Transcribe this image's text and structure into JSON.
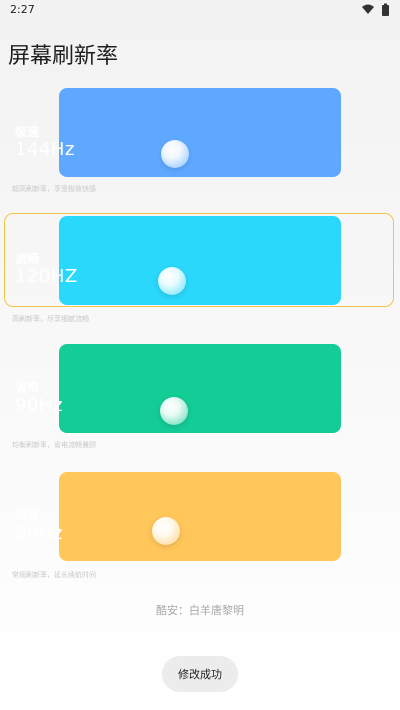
{
  "status_bar": {
    "time": "2:27",
    "icons": [
      "wifi-icon",
      "battery-icon"
    ]
  },
  "header": {
    "title": "屏幕刷新率"
  },
  "modes": [
    {
      "name": "极速",
      "rate": "144Hz",
      "description": "超高刷新率，享受极致快感",
      "color": "#5ea9ff",
      "selected": false
    },
    {
      "name": "流畅",
      "rate": "120HZ",
      "description": "高刷新率，尽享细腻流畅",
      "color": "#2ad8fb",
      "selected": true
    },
    {
      "name": "省电",
      "rate": "90Hz",
      "description": "均衡刷新率，省电流畅兼顾",
      "color": "#14cc96",
      "selected": false
    },
    {
      "name": "标准",
      "rate": "60Hz",
      "description": "常规刷新率，延长续航时间",
      "color": "#ffc65a",
      "selected": false
    }
  ],
  "credit": "酷安：白羊唐黎明",
  "toast": "修改成功",
  "colors": {
    "selection_border": "#f5c542",
    "title_text": "#1f1f1f"
  }
}
